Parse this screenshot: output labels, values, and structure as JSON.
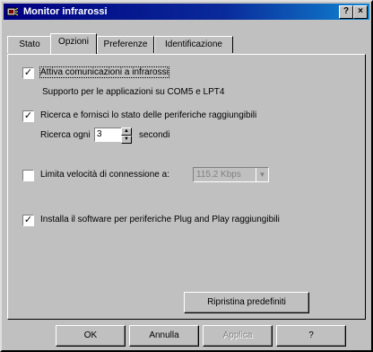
{
  "window": {
    "title": "Monitor infrarossi",
    "help_btn": "?",
    "close_btn": "×"
  },
  "tabs": [
    {
      "label": "Stato",
      "active": false
    },
    {
      "label": "Opzioni",
      "active": true
    },
    {
      "label": "Preferenze",
      "active": false
    },
    {
      "label": "Identificazione",
      "active": false
    }
  ],
  "options": {
    "enable_ir": {
      "label": "Attiva comunicazioni a infrarossi",
      "checked": true
    },
    "support_text": "Supporto per le applicazioni su COM5 e LPT4",
    "search": {
      "label": "Ricerca e fornisci lo stato delle periferiche raggiungibili",
      "checked": true
    },
    "search_every_label": "Ricerca ogni",
    "search_every_value": "3",
    "search_every_unit": "secondi",
    "limit_speed": {
      "label": "Limita velocità di connessione a:",
      "checked": false
    },
    "speed_value": "115.2 Kbps",
    "install_pnp": {
      "label": "Installa il software per periferiche Plug and Play raggiungibili",
      "checked": true
    },
    "restore_button": "Ripristina predefiniti"
  },
  "footer": {
    "ok": "OK",
    "cancel": "Annulla",
    "apply": "Applica",
    "help": "?"
  },
  "colors": {
    "titlebar_start": "#000080",
    "titlebar_end": "#1084d0",
    "face": "#c0c0c0"
  }
}
